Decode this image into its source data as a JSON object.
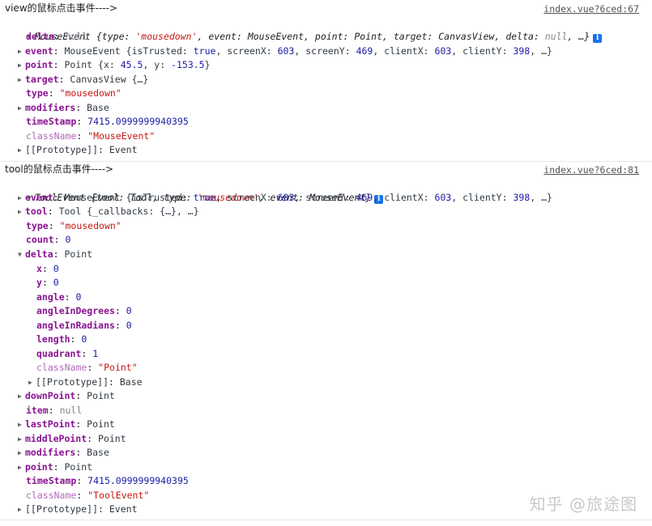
{
  "msg1": {
    "label": "view的鼠标点击事件---->",
    "source": "index.vue?6ced:67",
    "head": {
      "type": "MouseEvent",
      "preview": " {type: ",
      "t": "'mousedown'",
      "mid": ", event: MouseEvent, point: Point, target: CanvasView, delta: ",
      "d": "null",
      "end": ", …}"
    },
    "delta": {
      "k": "delta",
      "v": "null"
    },
    "event": {
      "k": "event",
      "pre": "MouseEvent {isTrusted: ",
      "trusted": "true",
      "a": ", screenX: ",
      "sx": "603",
      "b": ", screenY: ",
      "sy": "469",
      "c": ", clientX: ",
      "cx": "603",
      "d": ", clientY: ",
      "cy": "398",
      "e": ", …}"
    },
    "point": {
      "k": "point",
      "pre": "Point {x: ",
      "x": "45.5",
      "a": ", y: ",
      "y": "-153.5",
      "e": "}"
    },
    "target": {
      "k": "target",
      "v": "CanvasView {…}"
    },
    "type": {
      "k": "type",
      "v": "\"mousedown\""
    },
    "modifiers": {
      "k": "modifiers",
      "v": "Base"
    },
    "timeStamp": {
      "k": "timeStamp",
      "v": "7415.0999999940395"
    },
    "className": {
      "k": "className",
      "v": "\"MouseEvent\""
    },
    "proto": {
      "k": "[[Prototype]]",
      "v": "Event"
    }
  },
  "msg2": {
    "label": "tool的鼠标点击事件---->",
    "source": "index.vue?6ced:81",
    "head": {
      "type": "ToolEvent",
      "preview": " {tool: Tool, type: ",
      "t": "'mousedown'",
      "end": ", event: MouseEvent}"
    },
    "event": {
      "k": "event",
      "pre": "MouseEvent {isTrusted: ",
      "trusted": "true",
      "a": ", screenX: ",
      "sx": "603",
      "b": ", screenY: ",
      "sy": "469",
      "c": ", clientX: ",
      "cx": "603",
      "d": ", clientY: ",
      "cy": "398",
      "e": ", …}"
    },
    "tool": {
      "k": "tool",
      "v": "Tool {_callbacks: {…}, …}"
    },
    "type": {
      "k": "type",
      "v": "\"mousedown\""
    },
    "count": {
      "k": "count",
      "v": "0"
    },
    "delta": {
      "k": "delta",
      "v": "Point",
      "x": {
        "k": "x",
        "v": "0"
      },
      "y": {
        "k": "y",
        "v": "0"
      },
      "angle": {
        "k": "angle",
        "v": "0"
      },
      "angleInDegrees": {
        "k": "angleInDegrees",
        "v": "0"
      },
      "angleInRadians": {
        "k": "angleInRadians",
        "v": "0"
      },
      "length": {
        "k": "length",
        "v": "0"
      },
      "quadrant": {
        "k": "quadrant",
        "v": "1"
      },
      "className": {
        "k": "className",
        "v": "\"Point\""
      },
      "proto": {
        "k": "[[Prototype]]",
        "v": "Base"
      }
    },
    "downPoint": {
      "k": "downPoint",
      "v": "Point"
    },
    "item": {
      "k": "item",
      "v": "null"
    },
    "lastPoint": {
      "k": "lastPoint",
      "v": "Point"
    },
    "middlePoint": {
      "k": "middlePoint",
      "v": "Point"
    },
    "modifiers": {
      "k": "modifiers",
      "v": "Base"
    },
    "point": {
      "k": "point",
      "v": "Point"
    },
    "timeStamp": {
      "k": "timeStamp",
      "v": "7415.0999999940395"
    },
    "className": {
      "k": "className",
      "v": "\"ToolEvent\""
    },
    "proto": {
      "k": "[[Prototype]]",
      "v": "Event"
    }
  },
  "watermark": "知乎 @旅途图",
  "icons": {
    "expand": "triangle-right-icon",
    "collapse": "triangle-down-icon",
    "info": "info-icon"
  }
}
